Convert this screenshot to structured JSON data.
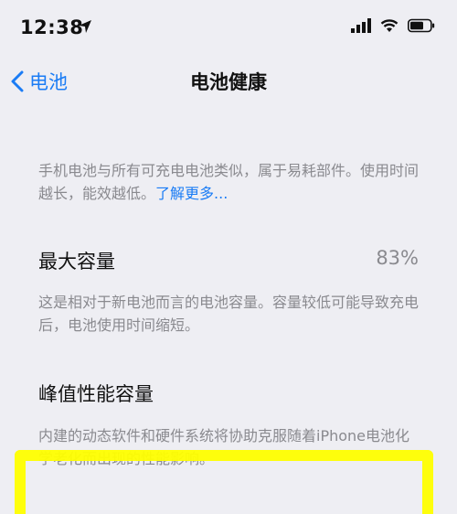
{
  "status": {
    "time": "12:38"
  },
  "nav": {
    "back_label": "电池",
    "title": "电池健康"
  },
  "intro": {
    "text": "手机电池与所有可充电电池类似，属于易耗部件。使用时间越长，能效越低。",
    "link": "了解更多..."
  },
  "max_capacity": {
    "label": "最大容量",
    "value": "83%",
    "description": "这是相对于新电池而言的电池容量。容量较低可能导致充电后，电池使用时间缩短。"
  },
  "peak_performance": {
    "label": "峰值性能容量",
    "description": "内建的动态软件和硬件系统将协助克服随着iPhone电池化学老化而出现的性能影响。"
  },
  "colors": {
    "accent": "#1a7cf5",
    "highlight": "#ffff00"
  }
}
